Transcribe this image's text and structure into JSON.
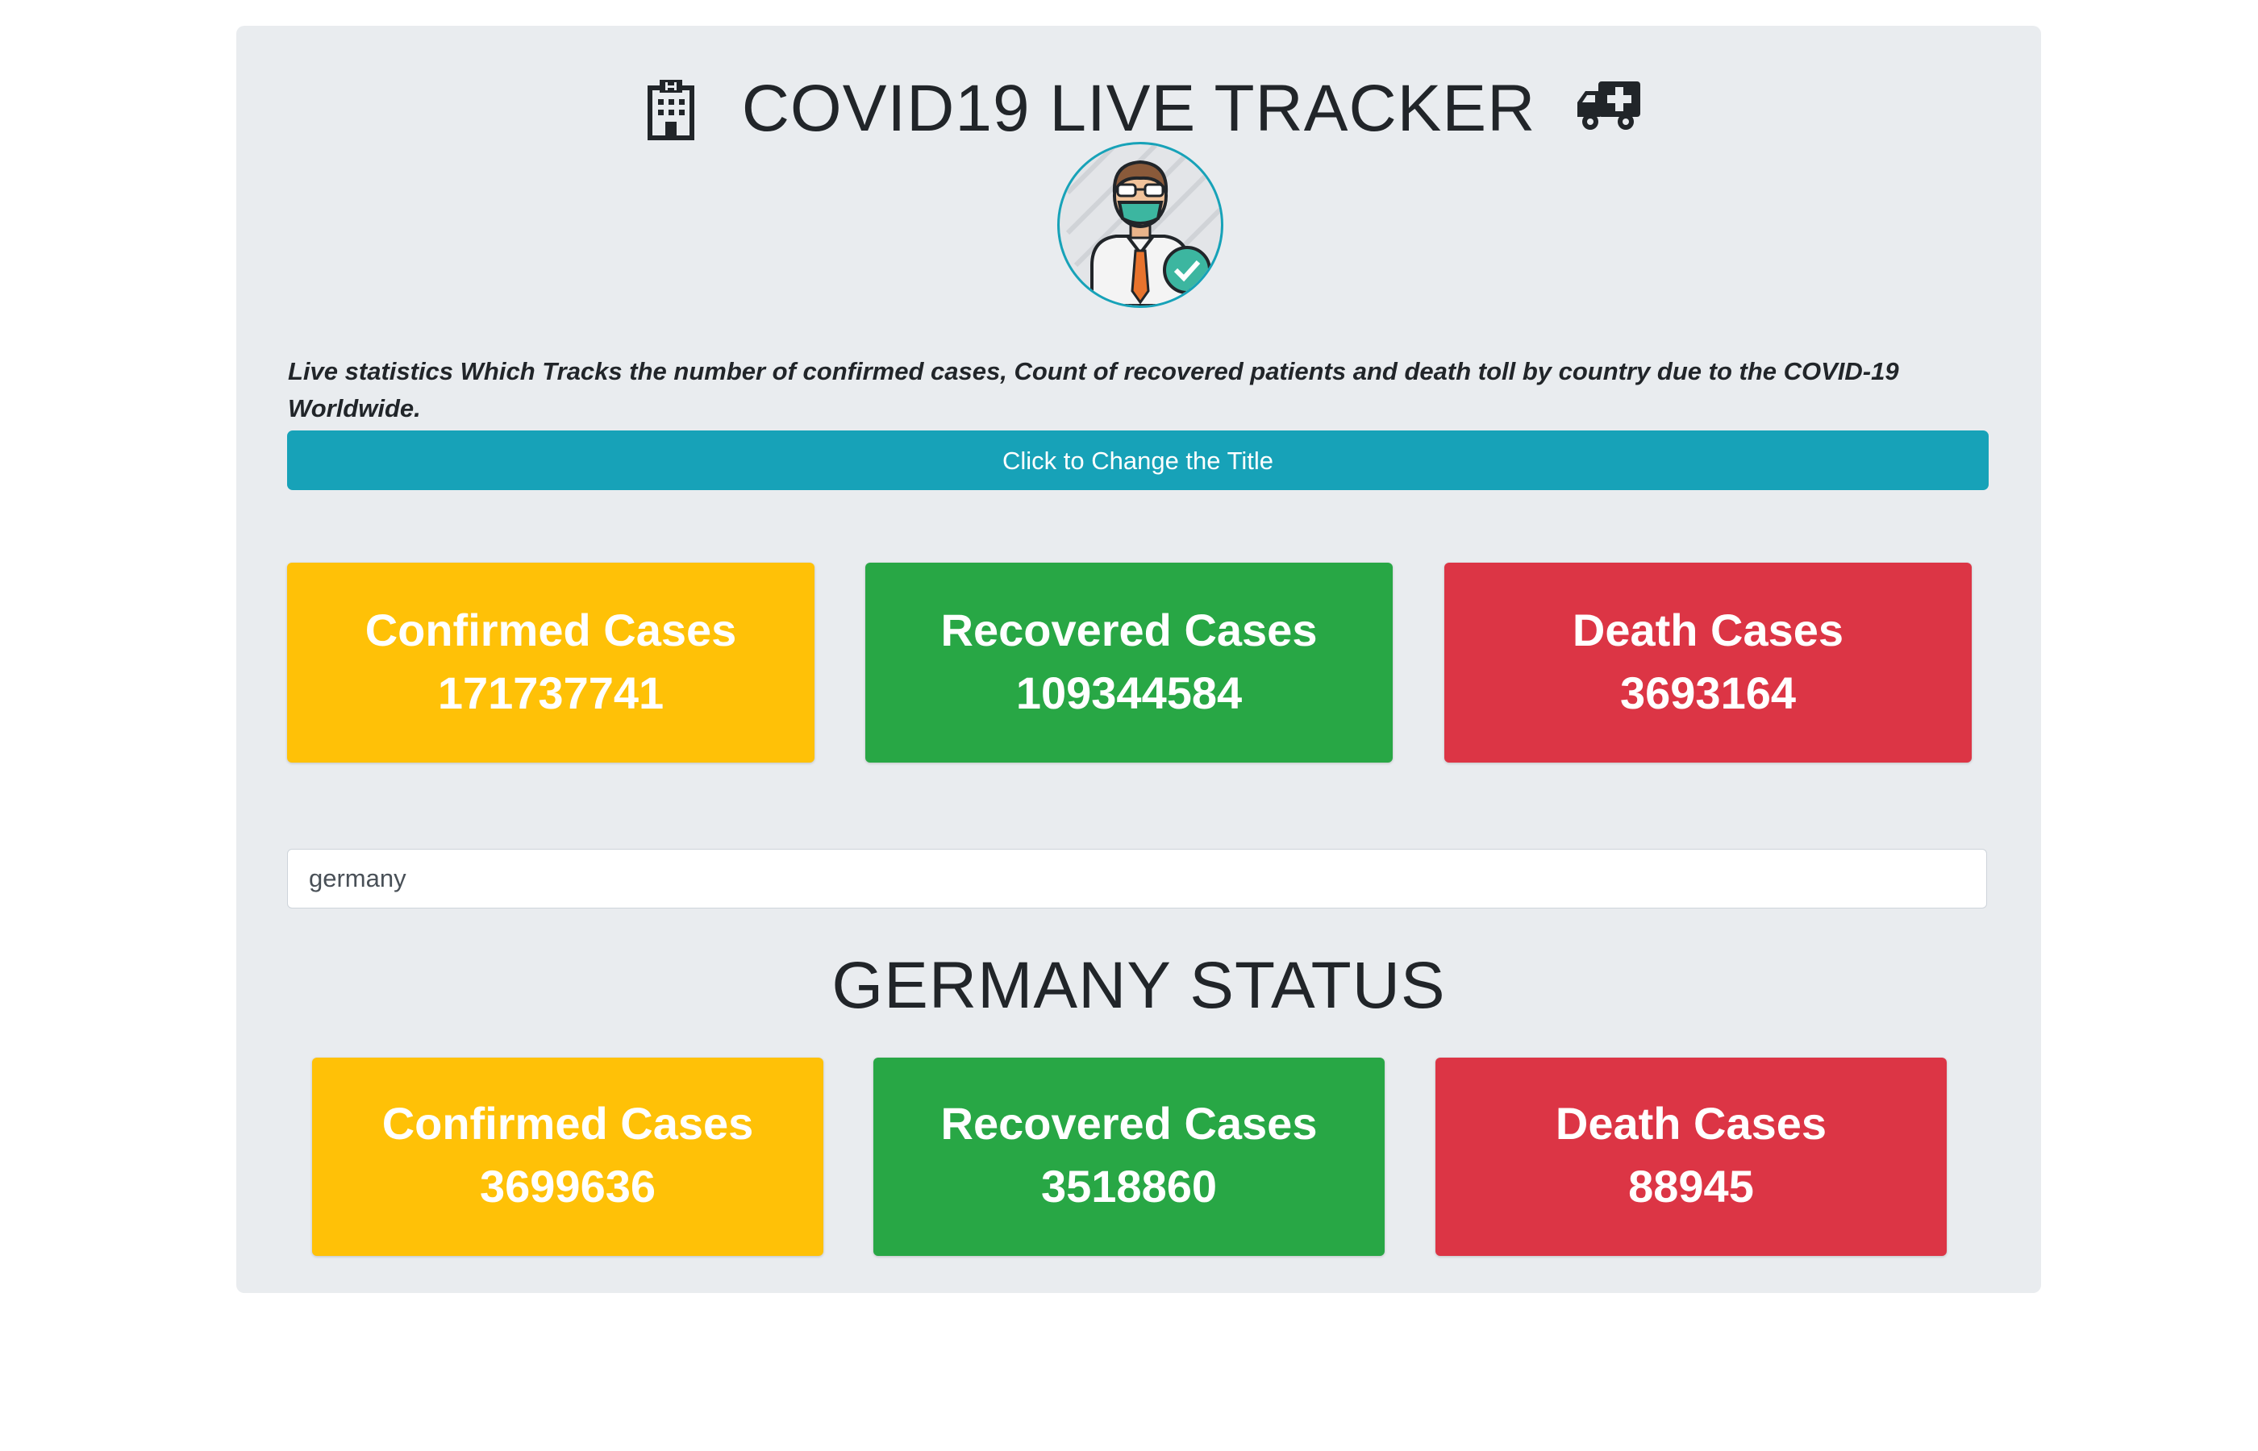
{
  "header": {
    "title": "COVID19 LIVE TRACKER",
    "left_icon": "hospital-icon",
    "right_icon": "ambulance-icon"
  },
  "avatar": {
    "icon": "doctor-with-mask-icon"
  },
  "description": "Live statistics Which Tracks the number of confirmed cases, Count of recovered patients and death toll by country due to the COVID-19 Worldwide.",
  "change_title_button": "Click to Change the Title",
  "global": {
    "confirmed": {
      "label": "Confirmed Cases",
      "value": "171737741"
    },
    "recovered": {
      "label": "Recovered Cases",
      "value": "109344584"
    },
    "deaths": {
      "label": "Death Cases",
      "value": "3693164"
    }
  },
  "search": {
    "value": "germany",
    "placeholder": ""
  },
  "country": {
    "status_title": "GERMANY STATUS",
    "confirmed": {
      "label": "Confirmed Cases",
      "value": "3699636"
    },
    "recovered": {
      "label": "Recovered Cases",
      "value": "3518860"
    },
    "deaths": {
      "label": "Death Cases",
      "value": "88945"
    }
  },
  "colors": {
    "confirmed": "#ffc107",
    "recovered": "#28a745",
    "deaths": "#dc3545",
    "button": "#17a2b8",
    "panel": "#e9ecef"
  }
}
